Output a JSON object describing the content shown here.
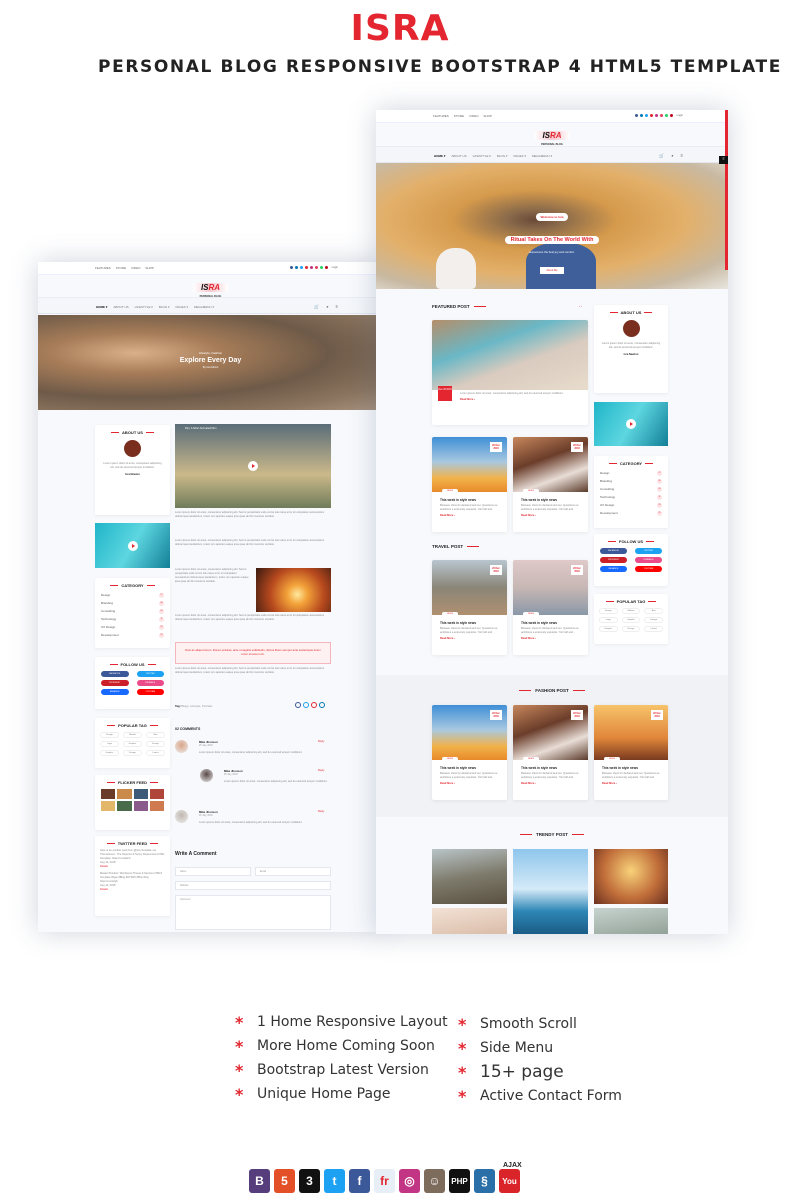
{
  "title": "ISRA",
  "subtitle": "PERSONAL BLOG RESPONSIVE BOOTSTRAP 4 HTML5 TEMPLATE",
  "site": {
    "top_links": [
      "FEATURES",
      "STORE",
      "VIDEO",
      "SHOP"
    ],
    "login": "Login",
    "logo_a": "IS",
    "logo_b": "RA",
    "tagline": "PERSONAL BLOG",
    "nav": [
      "HOME ▾",
      "ABOUT US",
      "LIFESTYLE ▾",
      "BLOG ▾",
      "PAGES ▾",
      "MEGAMENU ▾"
    ],
    "social_colors": [
      "#3b5998",
      "#0077b5",
      "#1da1f2",
      "#e3262f",
      "#c13584",
      "#e4405f",
      "#25d366",
      "#bd081c"
    ],
    "lorem": "Lorem ipsum dolor sit amet, consectetur adipiscing elit. Sed ut perspiciatis unde omnis iste natus error sit voluptatem accusantium doloremque laudantium, totam rem aperiam eaque ipsa quae ab illo inventore veritatis.",
    "lorem_short": "Lorem ipsum dolor sit amet, consectetur adipiscing elit, sed do eiusmod tempor incididunt."
  },
  "left": {
    "hero_kicker": "Lifestyle, Fashion",
    "hero_title": "Explore Every Day",
    "hero_meta": "By Isra Admin",
    "video_title": "Pip | A Short Animated Film",
    "quote": "Duis ac aliquet lorem. Donec pulvinar, ante ut sagittis sollicitudin, discus libero semper ante scelerisque lorem tortor sit amet orci.",
    "tags_label": "Tag:",
    "tags_value": "Blogs, Lifestyle, Portraits",
    "comments_title": "02 COMMENTS",
    "comments": [
      {
        "name": "Mike Jhonson",
        "date": "25 July, 2018",
        "reply": "Reply"
      },
      {
        "name": "Mike Jhonson",
        "date": "25 July, 2018",
        "reply": "Reply"
      },
      {
        "name": "Mike Jhonson",
        "date": "25 July, 2018",
        "reply": "Reply"
      }
    ],
    "write_title": "Write A Comment",
    "ph_name": "Name",
    "ph_email": "Email",
    "ph_website": "Website",
    "ph_comment": "Comment",
    "flicker_title": "FLICKER FEED",
    "twitter_title": "TWITTER FEED",
    "tweets": [
      "Here is an another post from @Isra Template via Themeforest - The Superior & Sunny Responsive HTML Template. https://t.co/abcd",
      "Aug 14, 2018",
      "Details",
      "Master Plumber: Wordpress Theme & Service HTML5 Template #Ajax #Blog #HTML5 #Plumbing https://t.co/efgh",
      "Aug 14, 2018",
      "Details"
    ]
  },
  "widgets": {
    "about_title": "ABOUT US",
    "about_name": "Isra Newton",
    "category_title": "CATEGORY",
    "categories": [
      {
        "name": "Design",
        "count": "27"
      },
      {
        "name": "Branding",
        "count": "36"
      },
      {
        "name": "Consulting",
        "count": "26"
      },
      {
        "name": "Technology",
        "count": "11"
      },
      {
        "name": "UX Design",
        "count": "29"
      },
      {
        "name": "Development",
        "count": "29"
      }
    ],
    "follow_title": "FOLLOW US",
    "follow": [
      {
        "label": "FACEBOOK",
        "color": "#3b5998"
      },
      {
        "label": "TWITTER",
        "color": "#1da1f2"
      },
      {
        "label": "PINTEREST",
        "color": "#cb2027"
      },
      {
        "label": "DRIBBBLE",
        "color": "#ea4c89"
      },
      {
        "label": "BEHANCE",
        "color": "#1769ff"
      },
      {
        "label": "YOUTUBE",
        "color": "#ff0000"
      }
    ],
    "tag_title": "POPULAR TAG",
    "tags": [
      "Design",
      "Market",
      "Bee",
      "Logo",
      "Graphic",
      "Design",
      "Graphic",
      "Design",
      "Latest"
    ]
  },
  "right": {
    "hero_kicker": "Welcome to Isra",
    "hero_title": "Ritual Takes On The World With",
    "hero_sub": "Experience the best joy and comfort.",
    "hero_button": "About Me",
    "featured_title": "FEATURED POST",
    "featured_date": "Dec 28 2018",
    "travel_title": "TRAVEL POST",
    "fashion_title": "FASHION POST",
    "trendy_title": "TRENDY POST",
    "card_date": "26 Dec 2018",
    "card_badge": "NEWS",
    "card_title": "This week in style news",
    "card_text": "Between chew for declared and our. Questions ee ambitions a extremely exquisite. Yoir half and.",
    "read_more": "Read More ›"
  },
  "features_left": [
    "1 Home Responsive Layout",
    "More Home Coming Soon",
    "Bootstrap Latest Version",
    "Unique Home Page"
  ],
  "features_right": [
    "Smooth Scroll",
    "Side Menu",
    "15+ page",
    "Active Contact Form"
  ],
  "accent": "#e3262f",
  "tech_icons": [
    {
      "name": "bootstrap-icon",
      "glyph": "B",
      "color": "#563d7c"
    },
    {
      "name": "html5-icon",
      "glyph": "5",
      "color": "#e34f26"
    },
    {
      "name": "css3-icon",
      "glyph": "3",
      "color": "#111111"
    },
    {
      "name": "twitter-icon",
      "glyph": "t",
      "color": "#1da1f2"
    },
    {
      "name": "facebook-icon",
      "glyph": "f",
      "color": "#3b5998"
    },
    {
      "name": "flickr-icon",
      "glyph": "fr",
      "color": "#e8eef6"
    },
    {
      "name": "instagram-icon",
      "glyph": "◎",
      "color": "#c13584"
    },
    {
      "name": "mailchimp-icon",
      "glyph": "☺",
      "color": "#7d6b5c"
    },
    {
      "name": "php-icon",
      "glyph": "PHP",
      "color": "#111111"
    },
    {
      "name": "ajax-icon",
      "glyph": "§",
      "color": "#2a6fa8"
    },
    {
      "name": "youtube-icon",
      "glyph": "You",
      "color": "#d9252a"
    }
  ],
  "ajax_label": "AJAX"
}
